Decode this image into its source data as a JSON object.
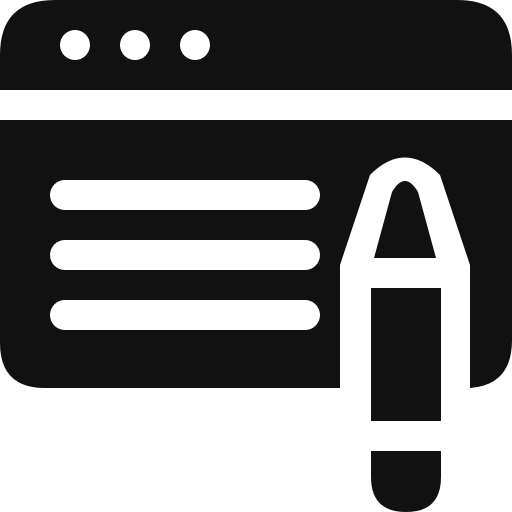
{
  "icon": {
    "name": "browser-window-with-pen-icon",
    "colors": {
      "ink": "#111111",
      "background": "#ffffff"
    },
    "title_bar": {
      "dots": [
        "window-dot-1",
        "window-dot-2",
        "window-dot-3"
      ]
    },
    "content": {
      "text_lines": 3
    },
    "pen": {
      "name": "pen-icon"
    }
  }
}
